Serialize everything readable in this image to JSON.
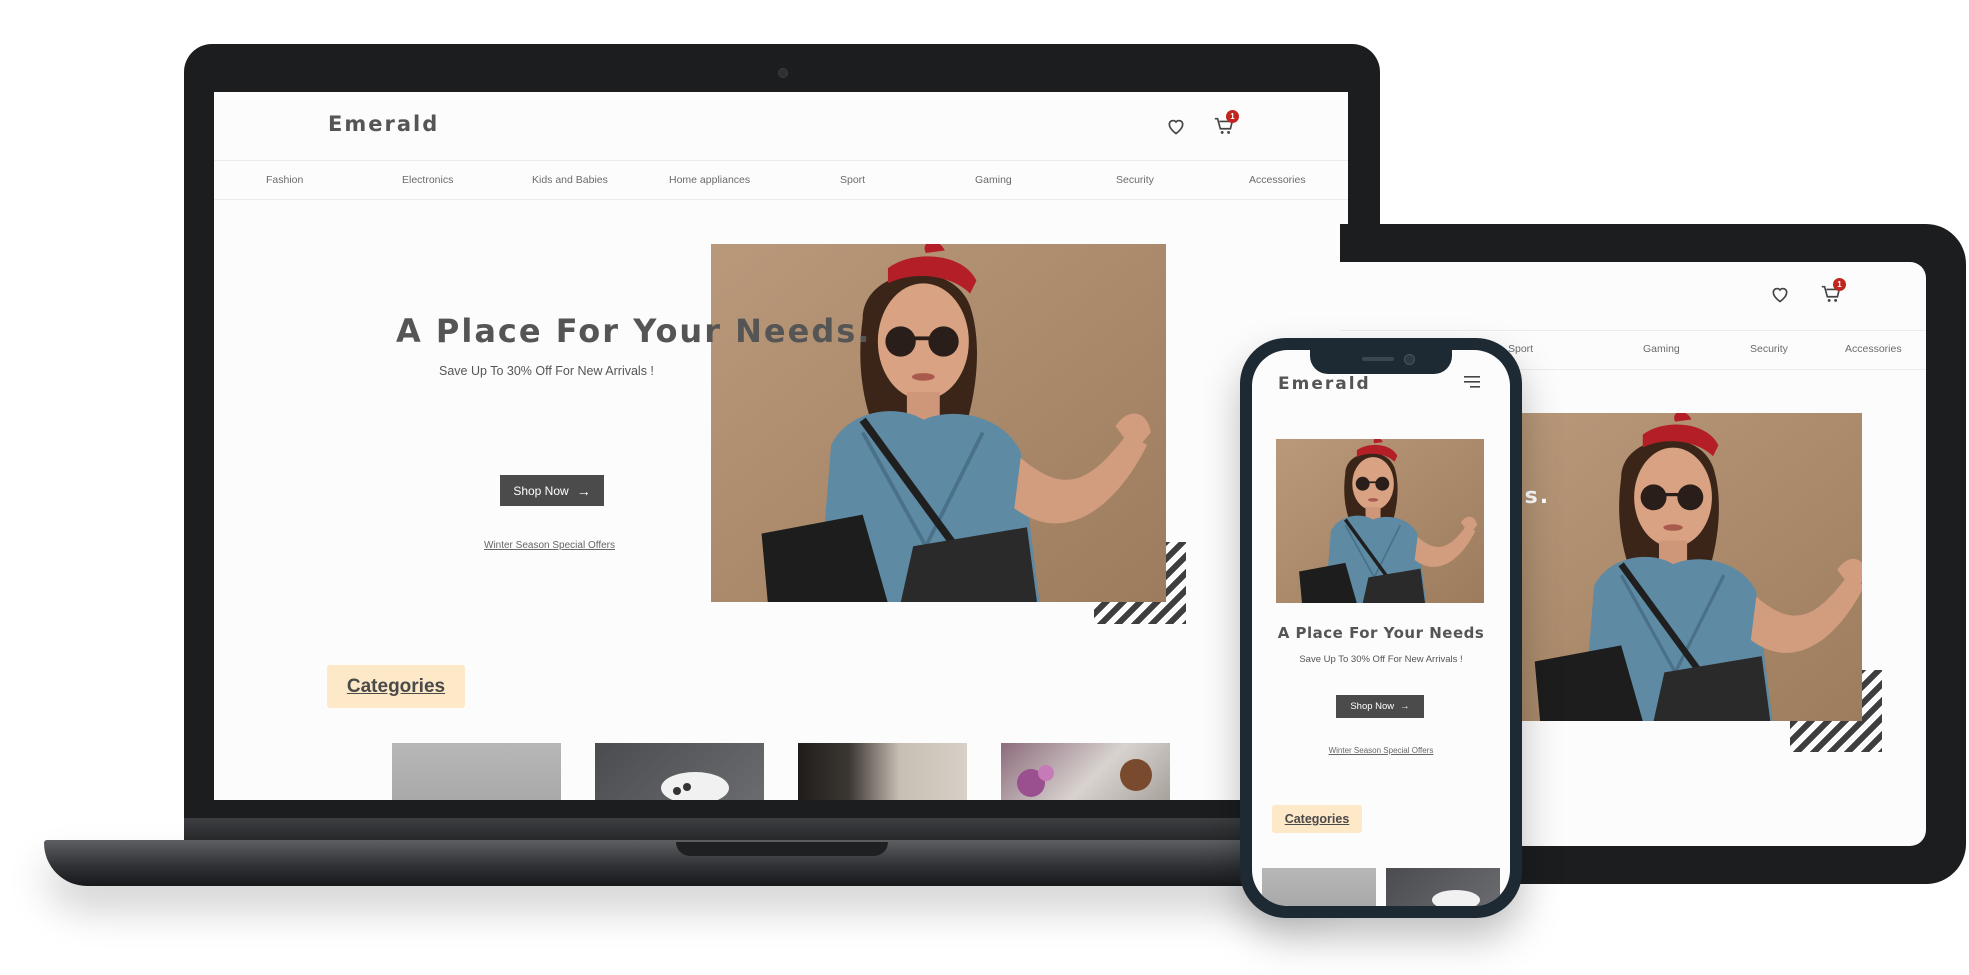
{
  "brand": "Emerald",
  "cart_count": "1",
  "nav": [
    "Fashion",
    "Electronics",
    "Kids and Babies",
    "Home appliances",
    "Sport",
    "Gaming",
    "Security",
    "Accessories"
  ],
  "tablet_nav": [
    "Sport",
    "Gaming",
    "Security",
    "Accessories"
  ],
  "hero": {
    "title": "A Place For Your Needs.",
    "title_mobile": "A Place For Your Needs",
    "title_tablet_fragment": "eds.",
    "subtitle": "Save Up To 30% Off For New Arrivals !",
    "button_label": "Shop Now",
    "button_arrow": "→",
    "offers_link": "Winter Season Special Offers"
  },
  "categories_label": "Categories",
  "icons": [
    "heart-icon",
    "cart-icon",
    "menu-icon",
    "arrow-right-icon"
  ],
  "colors": {
    "accent_badge": "#c0261f",
    "category_badge_bg": "#fde8c8",
    "button_bg": "#4b4b4b",
    "device_frame": "#1b1d1f"
  }
}
